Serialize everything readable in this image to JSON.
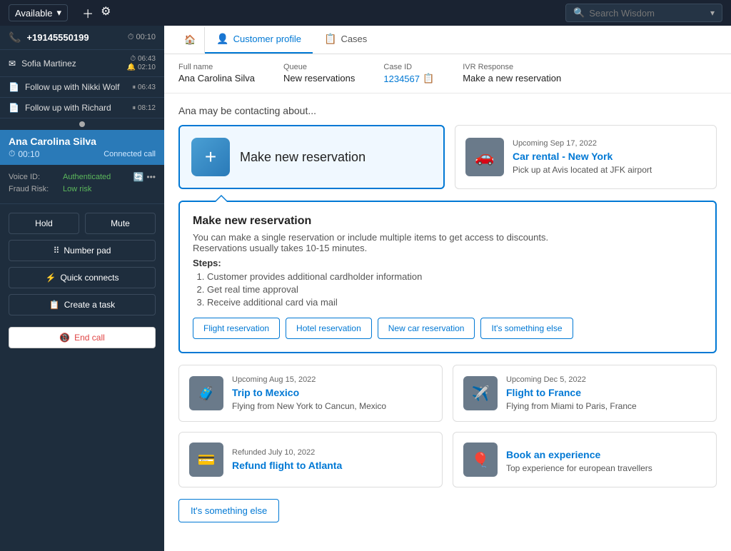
{
  "topbar": {
    "availability": "Available",
    "search_placeholder": "Search Wisdom"
  },
  "sidebar": {
    "active_call": {
      "number": "+19145550199",
      "duration": "00:10",
      "status_icon": "clock"
    },
    "contacts": [
      {
        "name": "Sofia Martinez",
        "time1": "06:43",
        "time2": "02:10"
      },
      {
        "name": "Follow up with Nikki Wolf",
        "time1": "06:43",
        "paused": true
      },
      {
        "name": "Follow up with Richard",
        "time1": "08:12",
        "paused": true
      }
    ],
    "current_caller": {
      "name": "Ana Carolina Silva",
      "timer": "00:10",
      "status": "Connected call"
    },
    "voice_id": "Authenticated",
    "fraud_risk": "Low risk",
    "buttons": {
      "hold": "Hold",
      "mute": "Mute",
      "number_pad": "Number pad",
      "quick_connects": "Quick connects",
      "create_task": "Create a task",
      "end_call": "End call"
    }
  },
  "tabs": {
    "home_icon": "🏠",
    "items": [
      {
        "label": "Customer profile",
        "icon": "👤",
        "active": true
      },
      {
        "label": "Cases",
        "icon": "📋",
        "active": false
      }
    ]
  },
  "customer": {
    "full_name_label": "Full name",
    "full_name": "Ana Carolina Silva",
    "queue_label": "Queue",
    "queue": "New reservations",
    "case_id_label": "Case ID",
    "case_id": "1234567",
    "ivr_label": "IVR Response",
    "ivr": "Make a new reservation"
  },
  "main": {
    "heading": "Ana may be contacting about...",
    "primary_card": {
      "icon": "+",
      "label": "Make new reservation"
    },
    "secondary_card": {
      "date": "Upcoming Sep 17, 2022",
      "title": "Car rental - New York",
      "desc": "Pick up at Avis located at JFK airport",
      "icon": "🚗"
    },
    "expanded": {
      "title": "Make new reservation",
      "description": "You can make a single reservation or include multiple items to get access to discounts.\nReservations usually takes 10-15 minutes.",
      "steps_label": "Steps:",
      "steps": [
        "Customer provides additional cardholder information",
        "Get real time approval",
        "Receive additional card via mail"
      ],
      "buttons": [
        "Flight reservation",
        "Hotel reservation",
        "New car reservation",
        "It's something else"
      ]
    },
    "bottom_cards": [
      {
        "date": "Upcoming Aug 15, 2022",
        "title": "Trip to Mexico",
        "desc": "Flying from New York to Cancun, Mexico",
        "icon": "🧳"
      },
      {
        "date": "Upcoming Dec 5, 2022",
        "title": "Flight to France",
        "desc": "Flying from Miami to Paris, France",
        "icon": "✈️"
      },
      {
        "date": "Refunded July 10, 2022",
        "title": "Refund flight to Atlanta",
        "desc": "",
        "icon": "💳"
      },
      {
        "date": "",
        "title": "Book an experience",
        "desc": "Top experience for european travellers",
        "icon": "🎈"
      }
    ],
    "something_else_btn": "It's something else"
  }
}
